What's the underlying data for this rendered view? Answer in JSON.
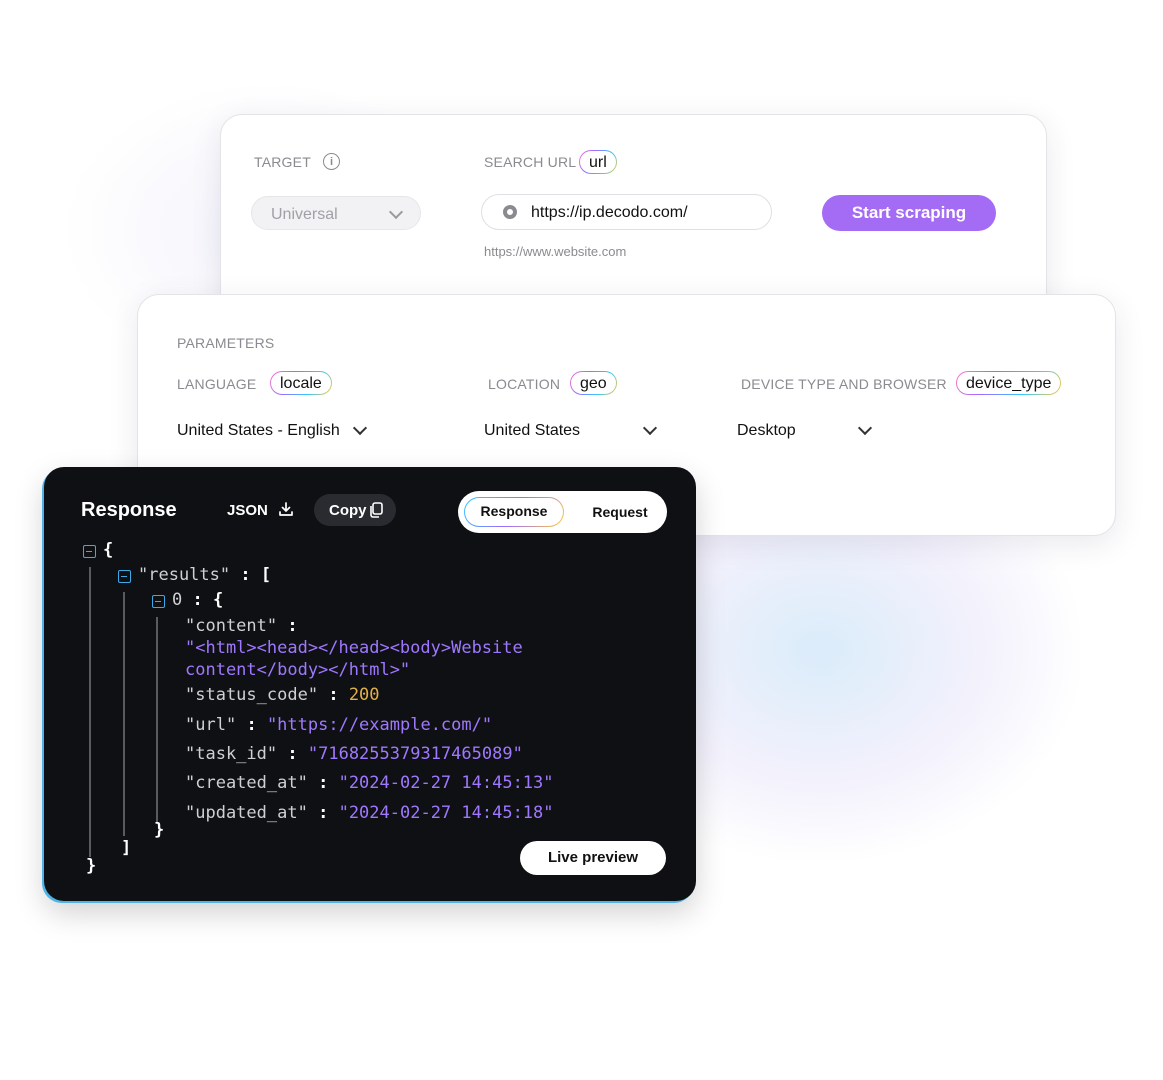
{
  "target_card": {
    "target_label": "TARGET",
    "target_value": "Universal",
    "search_url_label": "SEARCH URL",
    "url_tag": "url",
    "url_value": "https://ip.decodo.com/",
    "url_hint": "https://www.website.com",
    "start_button": "Start scraping"
  },
  "params_card": {
    "title": "PARAMETERS",
    "language_label": "LANGUAGE",
    "language_tag": "locale",
    "language_value": "United States - English",
    "location_label": "LOCATION",
    "location_tag": "geo",
    "location_value": "United States",
    "device_label": "DEVICE TYPE AND BROWSER",
    "device_tag": "device_type",
    "device_value": "Desktop"
  },
  "response_panel": {
    "title": "Response",
    "json_button": "JSON",
    "copy_button": "Copy",
    "tab_response": "Response",
    "tab_request": "Request",
    "live_preview": "Live preview",
    "code": {
      "results_key": "\"results\"",
      "index_key": "0",
      "content_key": "\"content\"",
      "content_line1": "\"<html><head></head><body>Website",
      "content_line2": "content</body></html>\"",
      "status_key": "\"status_code\"",
      "status_value": "200",
      "url_key": "\"url\"",
      "url_value": "\"https://example.com/\"",
      "task_key": "\"task_id\"",
      "task_value": "\"7168255379317465089\"",
      "created_key": "\"created_at\"",
      "created_value": "\"2024-02-27 14:45:13\"",
      "updated_key": "\"updated_at\"",
      "updated_value": "\"2024-02-27 14:45:18\""
    }
  },
  "colors": {
    "accent_purple": "#a46bf5",
    "panel_bg": "#0f1013",
    "string_color": "#9f78ff",
    "number_color": "#e2b04a",
    "tree_icon": "#3fa9e6"
  },
  "icons": [
    "info-icon",
    "chevron-down-icon",
    "globe-icon",
    "download-icon",
    "copy-icon",
    "collapse-icon"
  ]
}
